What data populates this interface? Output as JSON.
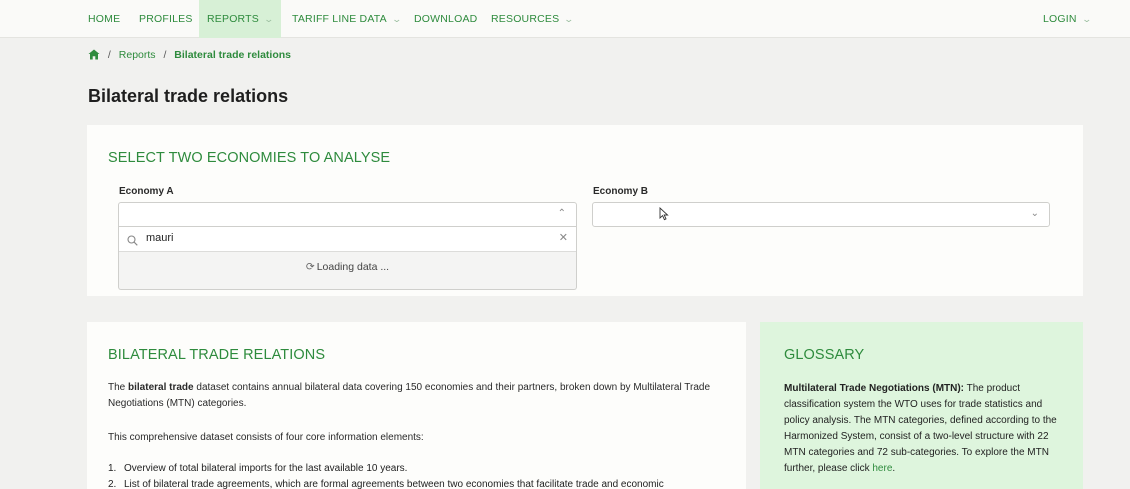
{
  "nav": {
    "home": "HOME",
    "profiles": "PROFILES",
    "reports": "REPORTS",
    "tariff": "TARIFF LINE DATA",
    "download": "DOWNLOAD",
    "resources": "RESOURCES",
    "login": "LOGIN",
    "accent_color": "#2e8b3d"
  },
  "breadcrumb": {
    "reports": "Reports",
    "separator": "/",
    "current": "Bilateral trade relations"
  },
  "page_title": "Bilateral trade relations",
  "selector": {
    "heading": "SELECT TWO ECONOMIES TO ANALYSE",
    "economy_a": {
      "label": "Economy A",
      "value": "",
      "search_value": "mauri",
      "status": "Loading data ..."
    },
    "economy_b": {
      "label": "Economy B",
      "value": ""
    }
  },
  "about": {
    "heading": "BILATERAL TRADE RELATIONS",
    "p1_before": "The ",
    "p1_bold": "bilateral trade",
    "p1_after": " dataset contains annual bilateral data covering 150 economies and their partners, broken down by Multilateral Trade Negotiations (MTN) categories.",
    "p2": "This comprehensive dataset consists of four core information elements:",
    "items": [
      {
        "num": "1.",
        "text": "Overview of total bilateral imports for the last available 10 years."
      },
      {
        "num": "2.",
        "text": "List of bilateral trade agreements, which are formal agreements between two economies that facilitate trade and economic"
      }
    ]
  },
  "glossary": {
    "heading": "GLOSSARY",
    "term": "Multilateral Trade Negotiations (MTN):",
    "definition": " The product classification system the WTO uses for trade statistics and policy analysis. The MTN categories, defined according to the Harmonized System, consist of a two-level structure with 22 MTN categories and 72 sub-categories. To explore the MTN further, please click ",
    "link": "here",
    "end": ".",
    "background": "#def5dd"
  }
}
